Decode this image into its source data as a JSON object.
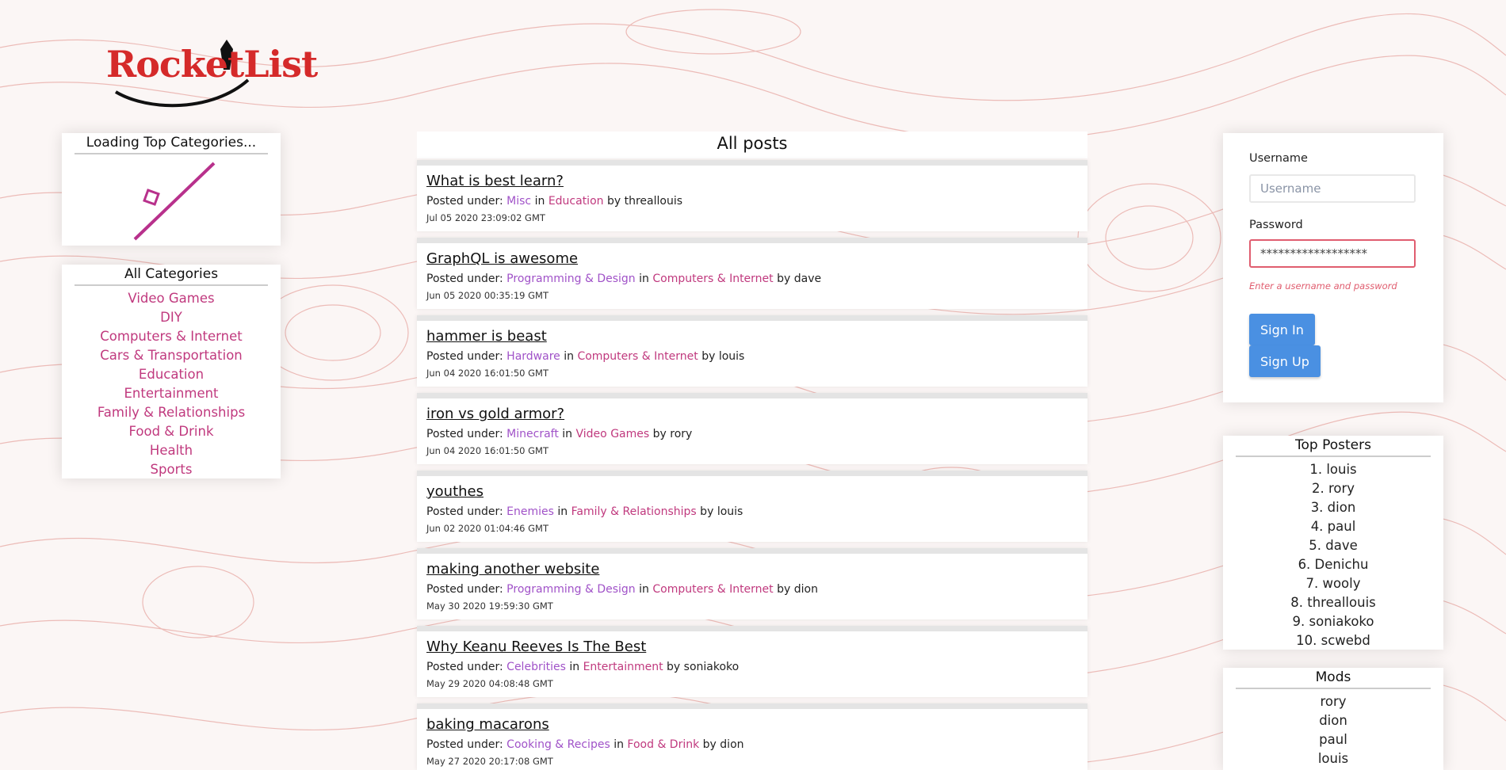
{
  "brand": {
    "logo_text": "RocketList",
    "accent": "#c0397e",
    "link_purple": "#a052c8",
    "button_blue": "#4a90e2"
  },
  "top_categories": {
    "title": "Loading Top Categories..."
  },
  "all_categories": {
    "title": "All Categories",
    "items": [
      "Video Games",
      "DIY",
      "Computers & Internet",
      "Cars & Transportation",
      "Education",
      "Entertainment",
      "Family & Relationships",
      "Food & Drink",
      "Health",
      "Sports"
    ]
  },
  "feed": {
    "title": "All posts",
    "posted_under_label": "Posted under: ",
    "in_label": " in ",
    "by_label": " by ",
    "posts": [
      {
        "title": "What is best learn?",
        "sub": "Misc",
        "category": "Education",
        "author": "threallouis",
        "date": "Jul 05 2020 23:09:02 GMT"
      },
      {
        "title": "GraphQL is awesome",
        "sub": "Programming & Design",
        "category": "Computers & Internet",
        "author": "dave",
        "date": "Jun 05 2020 00:35:19 GMT"
      },
      {
        "title": "hammer is beast",
        "sub": "Hardware",
        "category": "Computers & Internet",
        "author": "louis",
        "date": "Jun 04 2020 16:01:50 GMT"
      },
      {
        "title": "iron vs gold armor?",
        "sub": "Minecraft",
        "category": "Video Games",
        "author": "rory",
        "date": "Jun 04 2020 16:01:50 GMT"
      },
      {
        "title": "youthes",
        "sub": "Enemies",
        "category": "Family & Relationships",
        "author": "louis",
        "date": "Jun 02 2020 01:04:46 GMT"
      },
      {
        "title": "making another website",
        "sub": "Programming & Design",
        "category": "Computers & Internet",
        "author": "dion",
        "date": "May 30 2020 19:59:30 GMT"
      },
      {
        "title": "Why Keanu Reeves Is The Best",
        "sub": "Celebrities",
        "category": "Entertainment",
        "author": "soniakoko",
        "date": "May 29 2020 04:08:48 GMT"
      },
      {
        "title": "baking macarons",
        "sub": "Cooking & Recipes",
        "category": "Food & Drink",
        "author": "dion",
        "date": "May 27 2020 20:17:08 GMT"
      }
    ]
  },
  "login": {
    "username_label": "Username",
    "username_placeholder": "Username",
    "password_label": "Password",
    "password_value": "******************",
    "error": "Enter a username and password",
    "sign_in": "Sign In",
    "sign_up": "Sign Up"
  },
  "top_posters": {
    "title": "Top Posters",
    "items": [
      "1. louis",
      "2. rory",
      "3. dion",
      "4. paul",
      "5. dave",
      "6. Denichu",
      "7. wooly",
      "8. threallouis",
      "9. soniakoko",
      "10. scwebd"
    ]
  },
  "mods": {
    "title": "Mods",
    "items": [
      "rory",
      "dion",
      "paul",
      "louis"
    ]
  }
}
